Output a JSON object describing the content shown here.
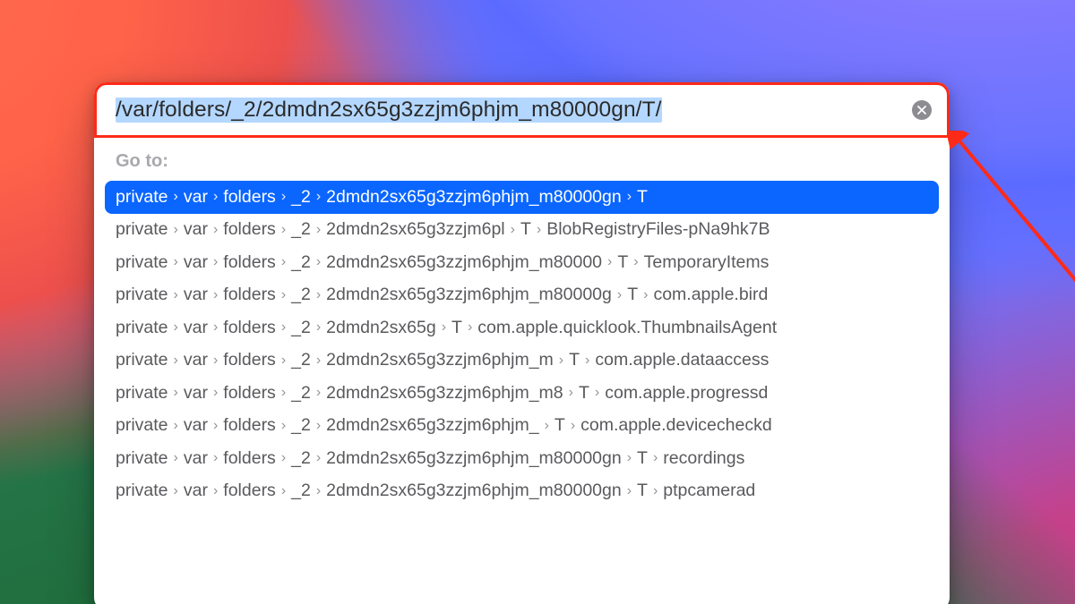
{
  "search": {
    "value": "/var/folders/_2/2dmdn2sx65g3zzjm6phjm_m80000gn/T/"
  },
  "section_label": "Go to:",
  "results": [
    {
      "selected": true,
      "segments": [
        "private",
        "var",
        "folders",
        "_2",
        "2dmdn2sx65g3zzjm6phjm_m80000gn",
        "T"
      ]
    },
    {
      "selected": false,
      "segments": [
        "private",
        "var",
        "folders",
        "_2",
        "2dmdn2sx65g3zzjm6pl",
        "T",
        "BlobRegistryFiles-pNa9hk7B"
      ],
      "trunc_index": 4
    },
    {
      "selected": false,
      "segments": [
        "private",
        "var",
        "folders",
        "_2",
        "2dmdn2sx65g3zzjm6phjm_m80000",
        "T",
        "TemporaryItems"
      ],
      "trunc_index": 4
    },
    {
      "selected": false,
      "segments": [
        "private",
        "var",
        "folders",
        "_2",
        "2dmdn2sx65g3zzjm6phjm_m80000g",
        "T",
        "com.apple.bird"
      ],
      "trunc_index": 4
    },
    {
      "selected": false,
      "segments": [
        "private",
        "var",
        "folders",
        "_2",
        "2dmdn2sx65g",
        "T",
        "com.apple.quicklook.ThumbnailsAgent"
      ],
      "trunc_index": 4
    },
    {
      "selected": false,
      "segments": [
        "private",
        "var",
        "folders",
        "_2",
        "2dmdn2sx65g3zzjm6phjm_m",
        "T",
        "com.apple.dataaccess"
      ],
      "trunc_index": 4
    },
    {
      "selected": false,
      "segments": [
        "private",
        "var",
        "folders",
        "_2",
        "2dmdn2sx65g3zzjm6phjm_m8",
        "T",
        "com.apple.progressd"
      ],
      "trunc_index": 4
    },
    {
      "selected": false,
      "segments": [
        "private",
        "var",
        "folders",
        "_2",
        "2dmdn2sx65g3zzjm6phjm_",
        "T",
        "com.apple.devicecheckd"
      ],
      "trunc_index": 4
    },
    {
      "selected": false,
      "segments": [
        "private",
        "var",
        "folders",
        "_2",
        "2dmdn2sx65g3zzjm6phjm_m80000gn",
        "T",
        "recordings"
      ]
    },
    {
      "selected": false,
      "segments": [
        "private",
        "var",
        "folders",
        "_2",
        "2dmdn2sx65g3zzjm6phjm_m80000gn",
        "T",
        "ptpcamerad"
      ]
    }
  ]
}
